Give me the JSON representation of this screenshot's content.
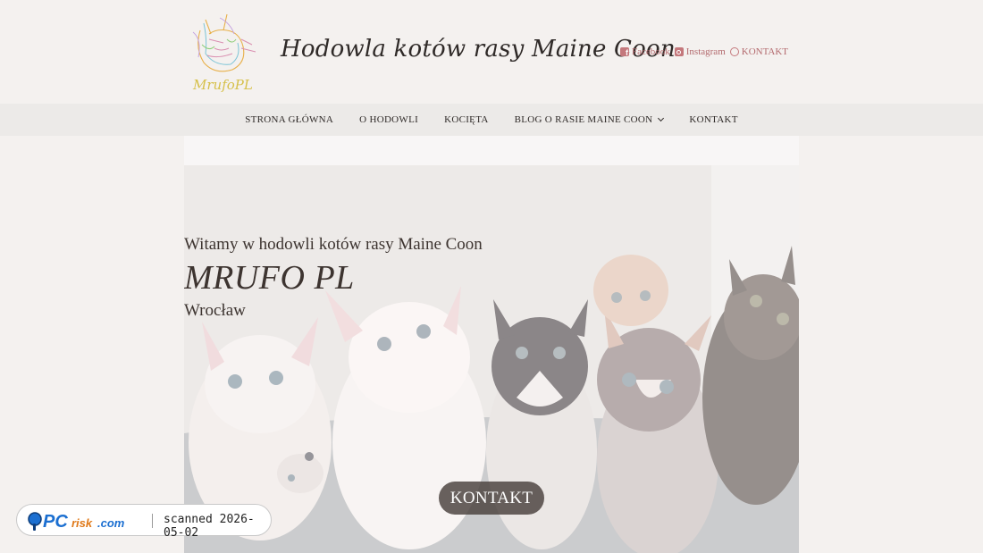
{
  "header": {
    "logo_text": "MrufoPL",
    "site_title": "Hodowla kotów rasy Maine Coon",
    "social": [
      {
        "label": "Facebook",
        "icon": "facebook-icon"
      },
      {
        "label": "Instagram",
        "icon": "instagram-icon"
      },
      {
        "label": "KONTAKT",
        "icon": "whatsapp-icon"
      }
    ]
  },
  "nav": {
    "items": [
      {
        "label": "STRONA GŁÓWNA"
      },
      {
        "label": "O HODOWLI"
      },
      {
        "label": "KOCIĘTA"
      },
      {
        "label": "BLOG O RASIE MAINE COON",
        "has_dropdown": true
      },
      {
        "label": "KONTAKT"
      }
    ]
  },
  "hero": {
    "line1": "Witamy w hodowli kotów rasy Maine Coon",
    "line2": "MRUFO PL",
    "line3": "Wrocław",
    "cta_label": "KONTAKT"
  },
  "badge": {
    "logo_text": "PCrisk.com",
    "scanned_text": "scanned 2026-05-02"
  },
  "colors": {
    "accent": "#b36a6e",
    "background": "#f4f1ef",
    "nav_bg": "#eceae8",
    "cta_bg": "#48403c"
  }
}
